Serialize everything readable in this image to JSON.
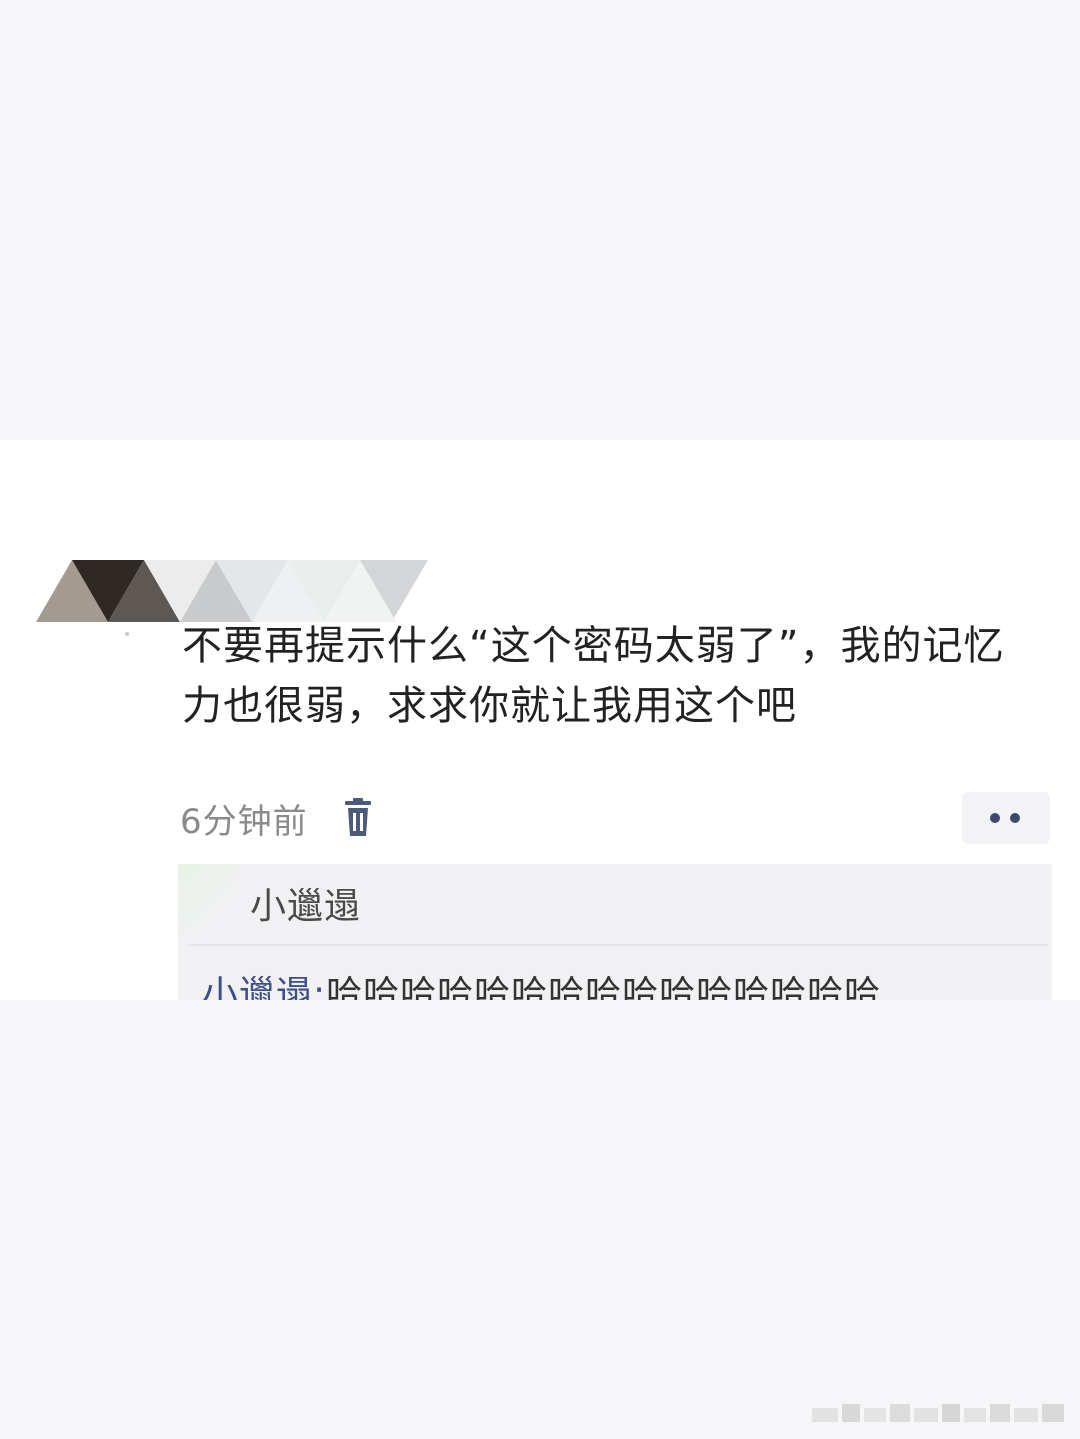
{
  "comment": {
    "text": "不要再提示什么“这个密码太弱了”，我的记忆力也很弱，求求你就让我用这个吧",
    "timestamp": "6分钟前"
  },
  "icons": {
    "avatar": "avatar-mosaic-icon",
    "delete": "trash-icon",
    "more": "more-dots-icon"
  },
  "reply": {
    "user_label": "小邋遢",
    "author": "小邋遢:",
    "content": "哈哈哈哈哈哈哈哈哈哈哈哈哈哈哈"
  },
  "colors": {
    "page_background": "#f6f6f8",
    "card_background": "#ffffff",
    "reply_background": "#f1f1f3",
    "reply_author": "#3e4f86",
    "timestamp": "#8a8a8a"
  }
}
